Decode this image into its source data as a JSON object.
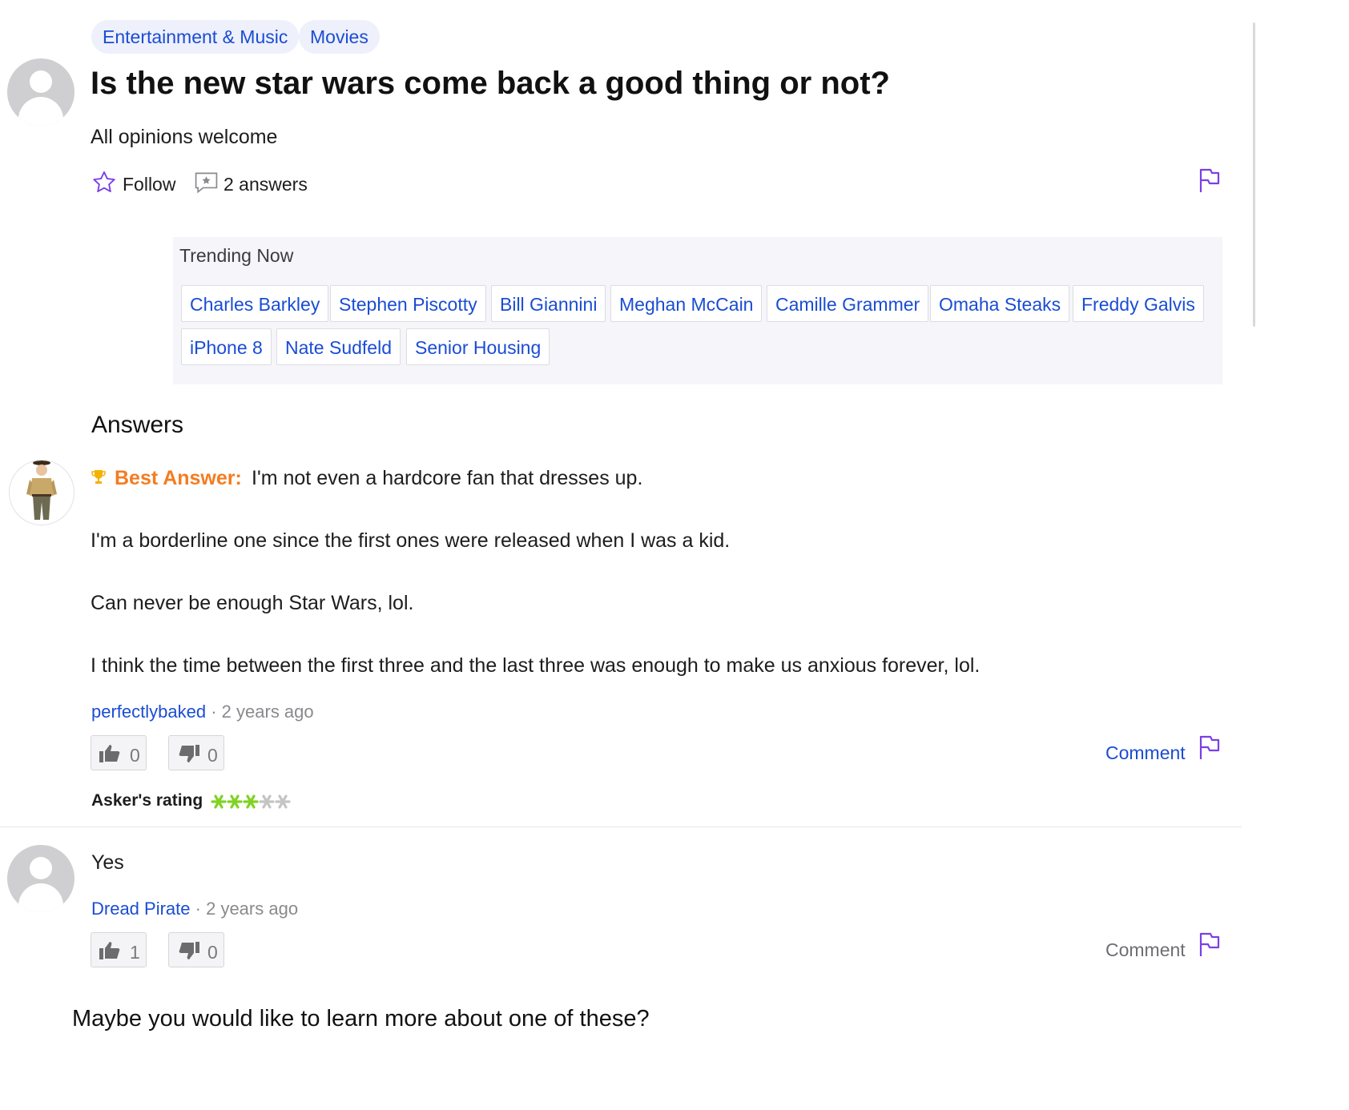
{
  "categories": [
    "Entertainment & Music",
    "Movies"
  ],
  "question": {
    "title": "Is the new star wars come back a good thing or not?",
    "details": "All opinions welcome",
    "follow_label": "Follow",
    "answers_count_label": "2 answers"
  },
  "trending": {
    "heading": "Trending Now",
    "items": [
      "Charles Barkley",
      "Stephen Piscotty",
      "Bill Giannini",
      "Meghan McCain",
      "Camille Grammer",
      "Omaha Steaks",
      "Freddy Galvis",
      "iPhone 8",
      "Nate Sudfeld",
      "Senior Housing"
    ]
  },
  "answers_heading": "Answers",
  "best_answer": {
    "label": "Best Answer:",
    "paragraphs": [
      "I'm not even a hardcore fan that dresses up.",
      "I'm a borderline one since the first ones were released when I was a kid.",
      "Can never be enough Star Wars, lol.",
      "I think the time between the first three and the last three was enough to make us anxious forever, lol."
    ],
    "author": "perfectlybaked",
    "separator": "·",
    "time": "2 years ago",
    "upvotes": "0",
    "downvotes": "0",
    "comment_label": "Comment",
    "asker_rating_label": "Asker's rating",
    "rating": 3,
    "rating_max": 5
  },
  "answer2": {
    "text": "Yes",
    "author": "Dread Pirate",
    "separator": "·",
    "time": "2 years ago",
    "upvotes": "1",
    "downvotes": "0",
    "comment_label": "Comment"
  },
  "more_heading": "Maybe you would like to learn more about one of these?",
  "colors": {
    "link": "#1a4dd4",
    "best_answer": "#f47c20",
    "flag": "#7b3fe4",
    "rating_on": "#7ed321",
    "rating_off": "#c4c4c4"
  },
  "icons": [
    "star-outline-icon",
    "answers-bubble-icon",
    "flag-icon",
    "trophy-icon",
    "thumbs-up-icon",
    "thumbs-down-icon",
    "rating-asterisk-icon"
  ]
}
